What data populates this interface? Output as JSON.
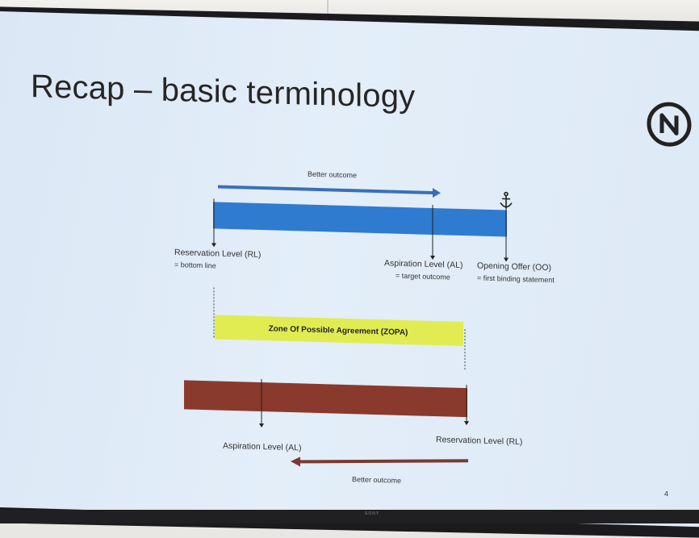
{
  "slide": {
    "title": "Recap – basic terminology",
    "page_number": "4",
    "logo_icon": "n-circle-logo"
  },
  "top_scale": {
    "better_outcome": "Better outcome",
    "reservation_level": "Reservation Level (RL)",
    "reservation_note": "= bottom line",
    "aspiration_level": "Aspiration Level (AL)",
    "aspiration_note": "= target outcome",
    "opening_offer": "Opening Offer (OO)",
    "opening_note": "= first binding statement",
    "anchor_icon": "anchor-icon",
    "bar_color": "#2f7bd0"
  },
  "zopa": {
    "label": "Zone Of Possible Agreement (ZOPA)",
    "color": "#e1ec52"
  },
  "bottom_scale": {
    "aspiration_level": "Aspiration  Level (AL)",
    "reservation_level": "Reservation Level (RL)",
    "better_outcome": "Better outcome",
    "bar_color": "#8a3a2c"
  },
  "monitor": {
    "brand": "SONY"
  }
}
